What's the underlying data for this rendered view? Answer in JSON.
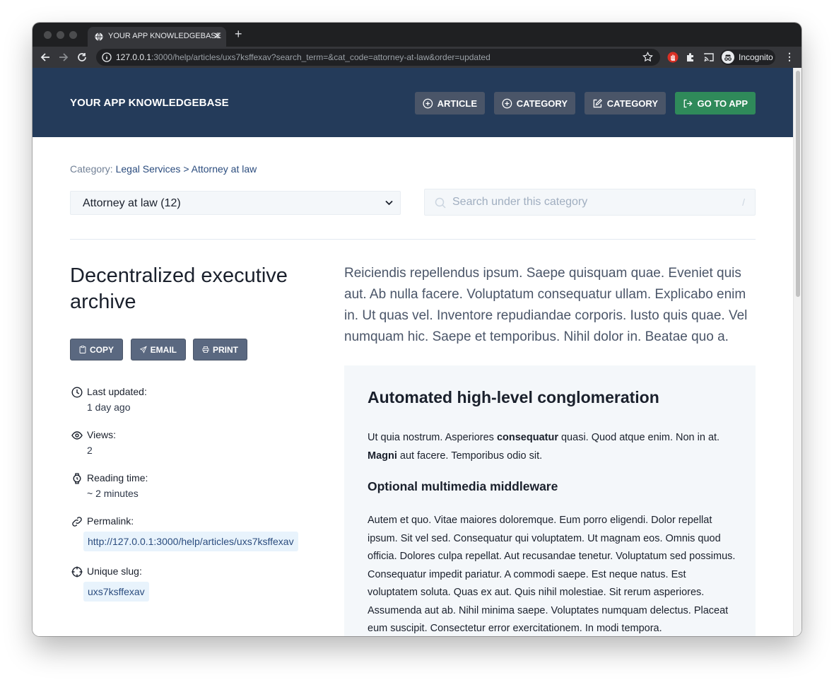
{
  "browser": {
    "tab_title": "YOUR APP KNOWLEDGEBASE",
    "tab_close": "✕",
    "new_tab": "+",
    "url_host": "127.0.0.1",
    "url_rest": ":3000/help/articles/uxs7ksffexav?search_term=&cat_code=attorney-at-law&order=updated",
    "profile_label": "Incognito",
    "menu": "⋮"
  },
  "header": {
    "brand": "YOUR APP KNOWLEDGEBASE",
    "buttons": {
      "article": "ARTICLE",
      "category_new": "CATEGORY",
      "category_edit": "CATEGORY",
      "go_to_app": "GO TO APP"
    },
    "colors": {
      "bg": "#243b5a",
      "button": "#4a5568",
      "go_button": "#2f8a5a"
    }
  },
  "breadcrumb": {
    "label": "Category:",
    "parent": "Legal Services",
    "sep": ">",
    "current": "Attorney at law"
  },
  "category_select": {
    "selected": "Attorney at law (12)"
  },
  "search": {
    "placeholder": "Search under this category",
    "shortcut": "/"
  },
  "article": {
    "title": "Decentralized executive archive",
    "actions": {
      "copy": "COPY",
      "email": "EMAIL",
      "print": "PRINT"
    },
    "meta": {
      "updated_label": "Last updated:",
      "updated_value": "1 day ago",
      "views_label": "Views:",
      "views_value": "2",
      "reading_label": "Reading time:",
      "reading_value": "~ 2 minutes",
      "permalink_label": "Permalink:",
      "permalink_value": "http://127.0.0.1:3000/help/articles/uxs7ksffexav",
      "slug_label": "Unique slug:",
      "slug_value": "uxs7ksffexav"
    },
    "lead": "Reiciendis repellendus ipsum. Saepe quisquam quae. Eveniet quis aut. Ab nulla facere. Voluptatum consequatur ullam. Explicabo enim in. Ut quas vel. Inventore repudiandae corporis. Iusto quis quae. Vel numquam hic. Saepe et temporibus. Nihil dolor in. Beatae quo a.",
    "body": {
      "h2": "Automated high-level conglomeration",
      "p1_a": "Ut quia nostrum. Asperiores ",
      "p1_b": "consequatur",
      "p1_c": " quasi. Quod atque enim. Non in at. ",
      "p1_d": "Magni",
      "p1_e": " aut facere. Temporibus odio sit.",
      "h3": "Optional multimedia middleware",
      "p2": "Autem et quo. Vitae maiores doloremque. Eum porro eligendi. Dolor repellat ipsum. Sit vel sed. Consequatur qui voluptatem. Ut magnam eos. Omnis quod officia. Dolores culpa repellat. Aut recusandae tenetur. Voluptatum sed possimus. Consequatur impedit pariatur. A commodi saepe. Est neque natus. Est voluptatem soluta. Quas ex aut. Quis nihil molestiae. Sit rerum asperiores. Assumenda aut ab. Nihil minima saepe. Voluptates numquam delectus. Placeat eum suscipit. Consectetur error exercitationem. In modi tempora."
    }
  }
}
